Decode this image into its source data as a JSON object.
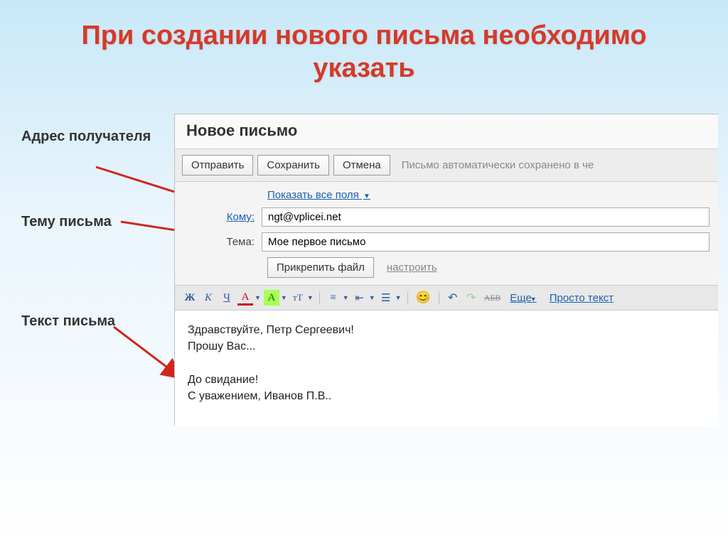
{
  "slide_title": "При создании нового письма необходимо указать",
  "annotations": {
    "recipient": "Адрес получателя",
    "subject": "Тему письма",
    "body": "Текст письма"
  },
  "compose": {
    "title": "Новое письмо",
    "toolbar": {
      "send": "Отправить",
      "save": "Сохранить",
      "cancel": "Отмена",
      "status": "Письмо автоматически сохранено в че"
    },
    "show_all_fields": "Показать все поля",
    "to_label": "Кому:",
    "to_value": "ngt@vplicei.net",
    "subject_label": "Тема:",
    "subject_value": "Мое первое письмо",
    "attach_button": "Прикрепить файл",
    "configure_link": "настроить",
    "format": {
      "bold": "Ж",
      "italic": "К",
      "underline": "Ч",
      "letter_a": "А",
      "highlight": "А",
      "fontsize": "тТ",
      "more": "Еще",
      "plain": "Просто текст",
      "strike_label": "АБВ"
    },
    "body": "Здравствуйте, Петр Сергеевич!\nПрошу Вас...\n\nДо свидание!\nС уважением, Иванов П.В.."
  }
}
